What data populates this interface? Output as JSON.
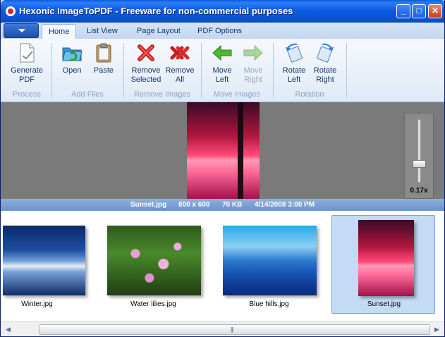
{
  "window": {
    "title": "Hexonic ImageToPDF - Freeware for non-commercial purposes",
    "controls": {
      "minimize": "_",
      "maximize": "□",
      "close": "✕"
    }
  },
  "tabs": [
    "Home",
    "List View",
    "Page Layout",
    "PDF Options"
  ],
  "active_tab": "Home",
  "ribbon": {
    "groups": [
      {
        "label": "Process",
        "buttons": [
          {
            "line1": "Generate",
            "line2": "PDF",
            "icon": "generate-pdf-icon"
          }
        ]
      },
      {
        "label": "Add Files",
        "buttons": [
          {
            "line1": "Open",
            "line2": "",
            "icon": "folder-open-icon"
          },
          {
            "line1": "Paste",
            "line2": "",
            "icon": "clipboard-icon"
          }
        ]
      },
      {
        "label": "Remove Images",
        "buttons": [
          {
            "line1": "Remove",
            "line2": "Selected",
            "icon": "red-x-icon"
          },
          {
            "line1": "Remove",
            "line2": "All",
            "icon": "double-red-x-icon"
          }
        ]
      },
      {
        "label": "Move Images",
        "buttons": [
          {
            "line1": "Move",
            "line2": "Left",
            "icon": "arrow-left-icon"
          },
          {
            "line1": "Move",
            "line2": "Right",
            "icon": "arrow-right-icon",
            "disabled": true
          }
        ]
      },
      {
        "label": "Rotation",
        "buttons": [
          {
            "line1": "Rotate",
            "line2": "Left",
            "icon": "rotate-left-icon"
          },
          {
            "line1": "Rotate",
            "line2": "Right",
            "icon": "rotate-right-icon"
          }
        ]
      }
    ]
  },
  "preview": {
    "zoom": "0.17x",
    "zoom_level": 0.17
  },
  "info": {
    "filename": "Sunset.jpg",
    "dimensions": "800 x 600",
    "size": "70 KB",
    "date": "4/14/2008 3:00 PM"
  },
  "thumbnails": [
    {
      "name": "Winter.jpg",
      "selected": false
    },
    {
      "name": "Water lilies.jpg",
      "selected": false
    },
    {
      "name": "Blue hills.jpg",
      "selected": false
    },
    {
      "name": "Sunset.jpg",
      "selected": true
    }
  ],
  "colors": {
    "titlebar": "#0b52d0",
    "selection": "#c4dbf4",
    "infobar": "#7a9fd4"
  }
}
